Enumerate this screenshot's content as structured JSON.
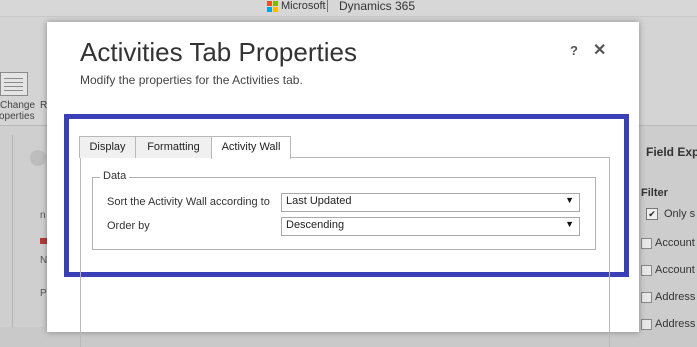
{
  "topbar": {
    "brand_ms": "Microsoft",
    "brand_app": "Dynamics 365"
  },
  "ribbon": {
    "change_label_1": "Change",
    "change_label_2": "operties",
    "next_label": "R"
  },
  "leftpane": {
    "t1": "n",
    "t2": "N",
    "t3": "P"
  },
  "rightpane": {
    "title": "Field Exp",
    "filter_label": "Filter",
    "only_label": "Only s",
    "rows": [
      "Account",
      "Account",
      "Address",
      "Address"
    ]
  },
  "dialog": {
    "title": "Activities Tab Properties",
    "subtitle": "Modify the properties for the Activities tab.",
    "help_label": "?",
    "close_label": "✕",
    "tabs": [
      {
        "label": "Display",
        "active": false
      },
      {
        "label": "Formatting",
        "active": false
      },
      {
        "label": "Activity Wall",
        "active": true
      }
    ],
    "fieldset": {
      "legend": "Data",
      "sort_label": "Sort the Activity Wall according to",
      "sort_value": "Last Updated",
      "order_label": "Order by",
      "order_value": "Descending"
    }
  },
  "colors": {
    "highlight": "#3b3fb8",
    "ms_red": "#f25022",
    "ms_green": "#7fba00",
    "ms_blue": "#00a4ef",
    "ms_yellow": "#ffb900"
  },
  "icons": {
    "dropdown": "▼",
    "help": "help-icon",
    "close": "close-icon",
    "checkbox": "✔"
  }
}
